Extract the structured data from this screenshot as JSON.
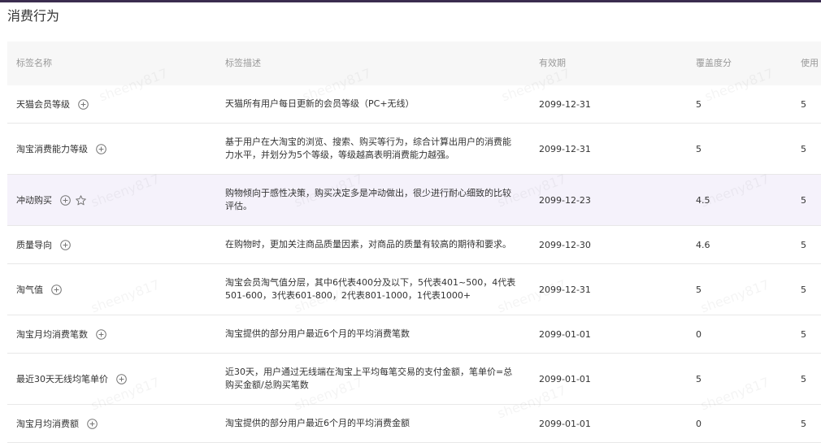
{
  "section_title": "消费行为",
  "columns": [
    "标签名称",
    "标签描述",
    "有效期",
    "覆盖度分",
    "使用"
  ],
  "watermark": "sheeny817",
  "rows": [
    {
      "name": "天猫会员等级",
      "desc": "天猫所有用户每日更新的会员等级（PC+无线）",
      "date": "2099-12-31",
      "coverage": "5",
      "usage": "5"
    },
    {
      "name": "淘宝消费能力等级",
      "desc": "基于用户在大淘宝的浏览、搜索、购买等行为，综合计算出用户的消费能力水平，并划分为5个等级，等级越高表明消费能力越强。",
      "date": "2099-12-31",
      "coverage": "5",
      "usage": "5"
    },
    {
      "name": "冲动购买",
      "desc": "购物倾向于感性决策，购买决定多是冲动做出，很少进行耐心细致的比较评估。",
      "date": "2099-12-23",
      "coverage": "4.5",
      "usage": "5"
    },
    {
      "name": "质量导向",
      "desc": "在购物时，更加关注商品质量因素，对商品的质量有较高的期待和要求。",
      "date": "2099-12-30",
      "coverage": "4.6",
      "usage": "5"
    },
    {
      "name": "淘气值",
      "desc": "淘宝会员淘气值分层，其中6代表400分及以下，5代表401~500，4代表501-600，3代表601-800，2代表801-1000，1代表1000+",
      "date": "2099-12-31",
      "coverage": "5",
      "usage": "5"
    },
    {
      "name": "淘宝月均消费笔数",
      "desc": "淘宝提供的部分用户最近6个月的平均消费笔数",
      "date": "2099-01-01",
      "coverage": "0",
      "usage": "5"
    },
    {
      "name": "最近30天无线均笔单价",
      "desc": "近30天，用户通过无线端在淘宝上平均每笔交易的支付金额，笔单价=总购买金额/总购买笔数",
      "date": "2099-01-01",
      "coverage": "5",
      "usage": "5"
    },
    {
      "name": "淘宝月均消费额",
      "desc": "淘宝提供的部分用户最近6个月的平均消费金额",
      "date": "2099-01-01",
      "coverage": "0",
      "usage": "5"
    }
  ]
}
